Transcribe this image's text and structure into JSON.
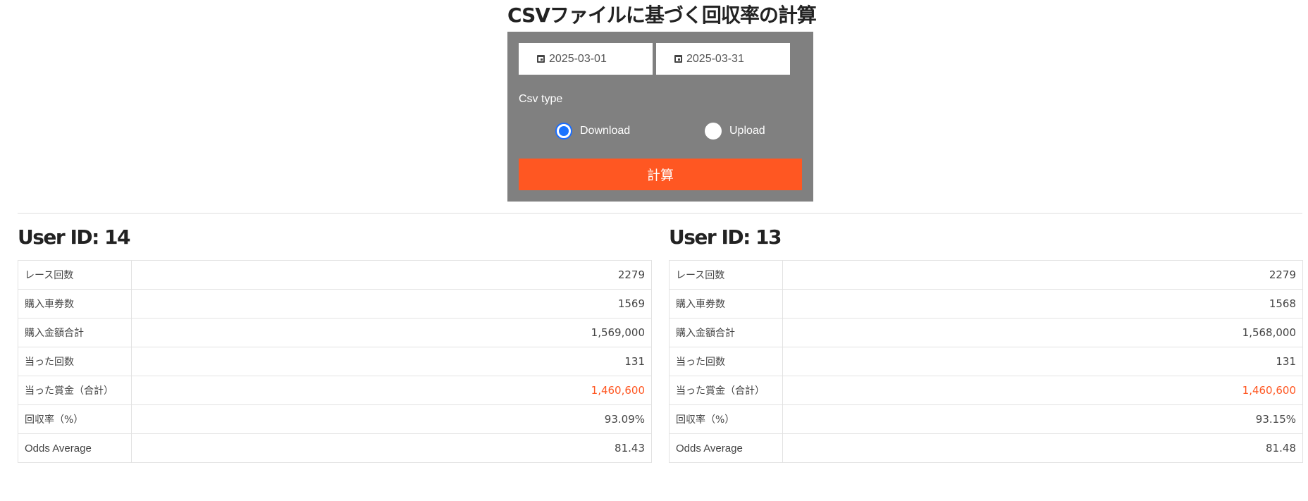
{
  "page": {
    "title": "CSVファイルに基づく回収率の計算"
  },
  "form": {
    "start_date": "2025-03-01",
    "end_date": "2025-03-31",
    "csv_type_label": "Csv type",
    "radio_options": [
      {
        "label": "Download",
        "selected": true
      },
      {
        "label": "Upload",
        "selected": false
      }
    ],
    "submit_label": "計算",
    "colors": {
      "panel": "#808080",
      "submit": "#ff5722",
      "radio_selected": "#1a73ff"
    }
  },
  "users": [
    {
      "title": "User ID: 14",
      "rows": [
        {
          "label": "レース回数",
          "value": "2279"
        },
        {
          "label": "購入車券数",
          "value": "1569"
        },
        {
          "label": "購入金額合計",
          "value": "1,569,000"
        },
        {
          "label": "当った回数",
          "value": "131"
        },
        {
          "label": "当った賞金（合計）",
          "value": "1,460,600"
        },
        {
          "label": "回収率（%）",
          "value": "93.09%"
        },
        {
          "label": "Odds Average",
          "value": "81.43"
        }
      ]
    },
    {
      "title": "User ID: 13",
      "rows": [
        {
          "label": "レース回数",
          "value": "2279"
        },
        {
          "label": "購入車券数",
          "value": "1568"
        },
        {
          "label": "購入金額合計",
          "value": "1,568,000"
        },
        {
          "label": "当った回数",
          "value": "131"
        },
        {
          "label": "当った賞金（合計）",
          "value": "1,460,600"
        },
        {
          "label": "回収率（%）",
          "value": "93.15%"
        },
        {
          "label": "Odds Average",
          "value": "81.48"
        }
      ]
    }
  ],
  "highlight_color": "#ff5722"
}
